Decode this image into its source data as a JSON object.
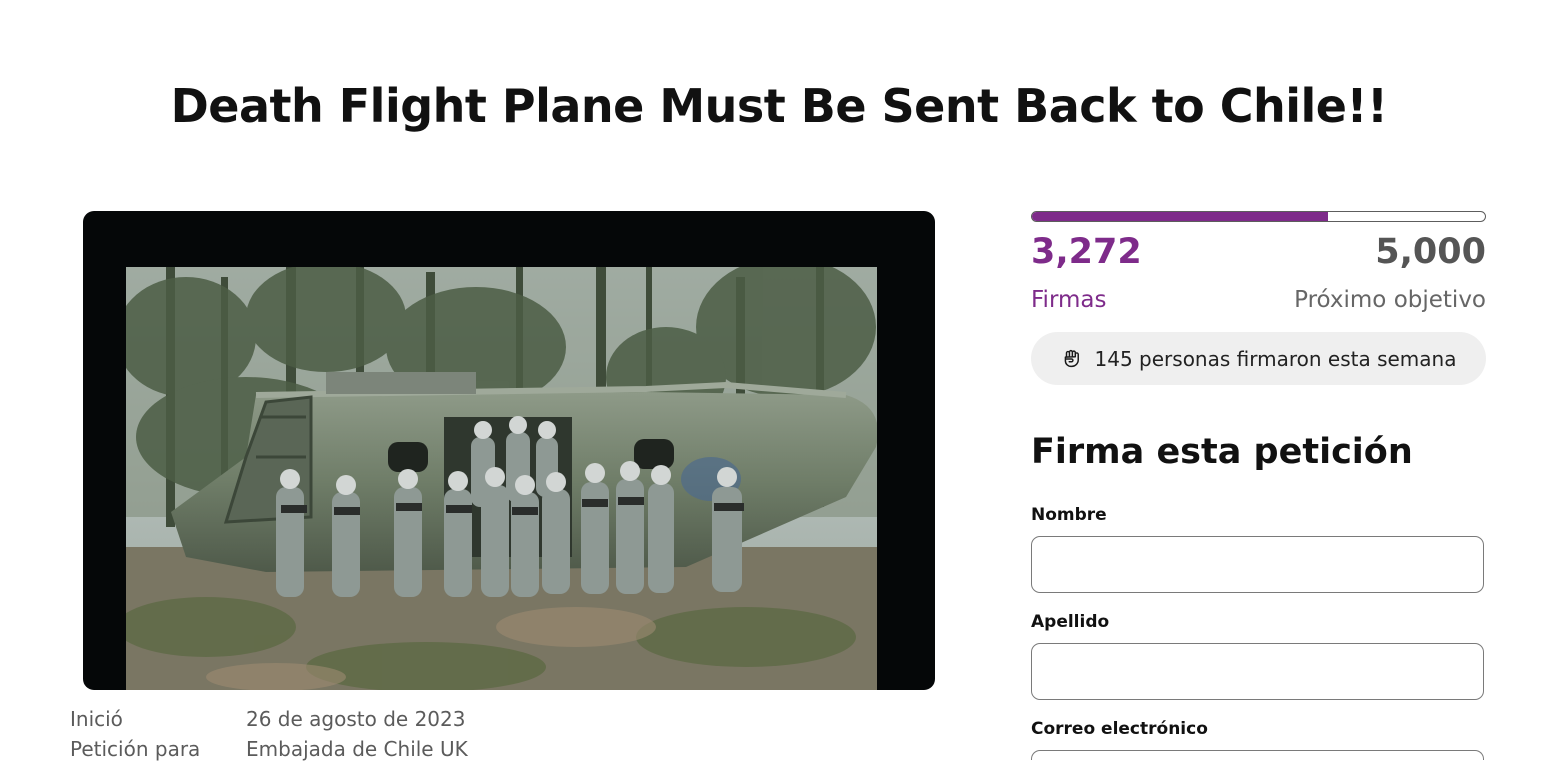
{
  "petition": {
    "title": "Death Flight Plane Must Be Sent Back to Chile!!",
    "image_alt": "Personas con equipo de paintball frente a un avión abandonado en el bosque"
  },
  "meta": {
    "started_label": "Inició",
    "started_value": "26 de agosto de 2023",
    "target_label": "Petición para",
    "target_value": "Embajada de Chile UK"
  },
  "progress": {
    "signatures": "3,272",
    "goal": "5,000",
    "fraction": 0.6544,
    "signatures_label": "Firmas",
    "goal_label": "Próximo objetivo",
    "weekly_text": "145 personas firmaron esta semana",
    "weekly_icon": "raised-fist-icon",
    "accent_color": "#7e2b8a"
  },
  "form": {
    "title": "Firma esta petición",
    "first_name_label": "Nombre",
    "last_name_label": "Apellido",
    "email_label": "Correo electrónico"
  }
}
